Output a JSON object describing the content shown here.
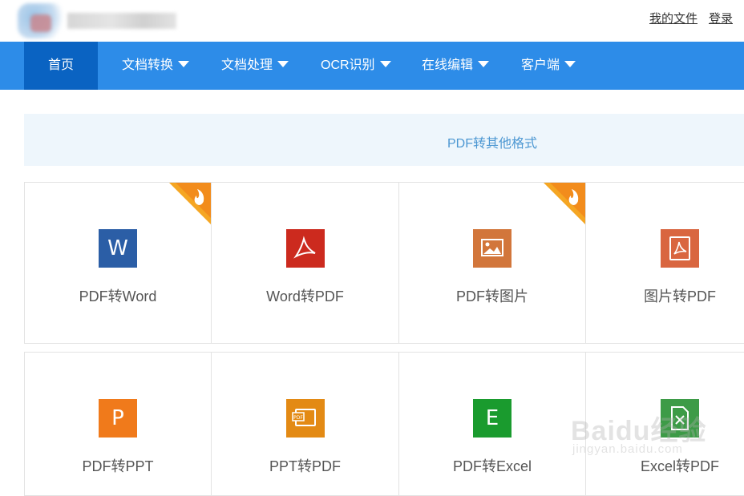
{
  "header": {
    "user_links": [
      "我的文件",
      "登录"
    ]
  },
  "nav": {
    "items": [
      {
        "label": "首页",
        "active": true
      },
      {
        "label": "文档转换",
        "dropdown": true
      },
      {
        "label": "文档处理",
        "dropdown": true
      },
      {
        "label": "OCR识别",
        "dropdown": true
      },
      {
        "label": "在线编辑",
        "dropdown": true
      },
      {
        "label": "客户端",
        "dropdown": true
      }
    ]
  },
  "section": {
    "title": "PDF转其他格式"
  },
  "tiles": [
    {
      "label": "PDF转Word",
      "icon": "word-icon",
      "glyph": "W",
      "color": "#2b5ea6",
      "hot": true
    },
    {
      "label": "Word转PDF",
      "icon": "pdf-icon",
      "color": "#cc2a1e",
      "hot": false
    },
    {
      "label": "PDF转图片",
      "icon": "image-icon",
      "color": "#d2763b",
      "hot": true
    },
    {
      "label": "图片转PDF",
      "icon": "pdf-icon",
      "color": "#d96640",
      "hot": false
    },
    {
      "label": "PDF转PPT",
      "icon": "ppt-icon",
      "glyph": "P",
      "color": "#f07a1b",
      "hot": false
    },
    {
      "label": "PPT转PDF",
      "icon": "ppt-pdf-icon",
      "color": "#e38a14",
      "hot": false
    },
    {
      "label": "PDF转Excel",
      "icon": "excel-icon",
      "glyph": "E",
      "color": "#1a9b2e",
      "hot": false
    },
    {
      "label": "Excel转PDF",
      "icon": "excel-pdf-icon",
      "color": "#3d9b47",
      "hot": false
    }
  ],
  "watermark": {
    "text": "Baidu经验",
    "sub": "jingyan.baidu.com"
  },
  "colors": {
    "nav_bg": "#2d8ce8",
    "nav_active": "#0a63c2",
    "hot_ribbon": "#f5a623"
  }
}
